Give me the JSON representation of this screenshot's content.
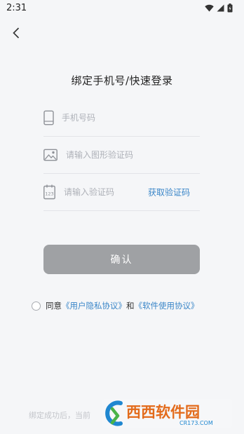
{
  "status_bar": {
    "time": "2:31",
    "icons": [
      "wifi-icon",
      "cell-signal-icon",
      "battery-icon"
    ]
  },
  "nav": {
    "back_icon": "chevron-left-icon"
  },
  "page": {
    "title": "绑定手机号/快速登录"
  },
  "form": {
    "phone": {
      "placeholder": "手机号码",
      "icon": "phone-icon"
    },
    "captcha": {
      "placeholder": "请输入图形验证码",
      "icon": "image-icon"
    },
    "code": {
      "placeholder": "请输入验证码",
      "icon": "code-keypad-icon",
      "action_label": "获取验证码"
    },
    "confirm_label": "确认"
  },
  "agreement": {
    "prefix": "同意",
    "user_link": "《用户隐私协议》",
    "and": "和",
    "software_link": "《软件使用协议》"
  },
  "footer": {
    "text": "绑定成功后，当前"
  },
  "watermark": {
    "name": "西西软件园",
    "domain": "CR173.COM"
  },
  "colors": {
    "background": "#f5f6f8",
    "link": "#3a86c8",
    "button": "#9fa1a4",
    "divider": "#e3e4e8"
  }
}
